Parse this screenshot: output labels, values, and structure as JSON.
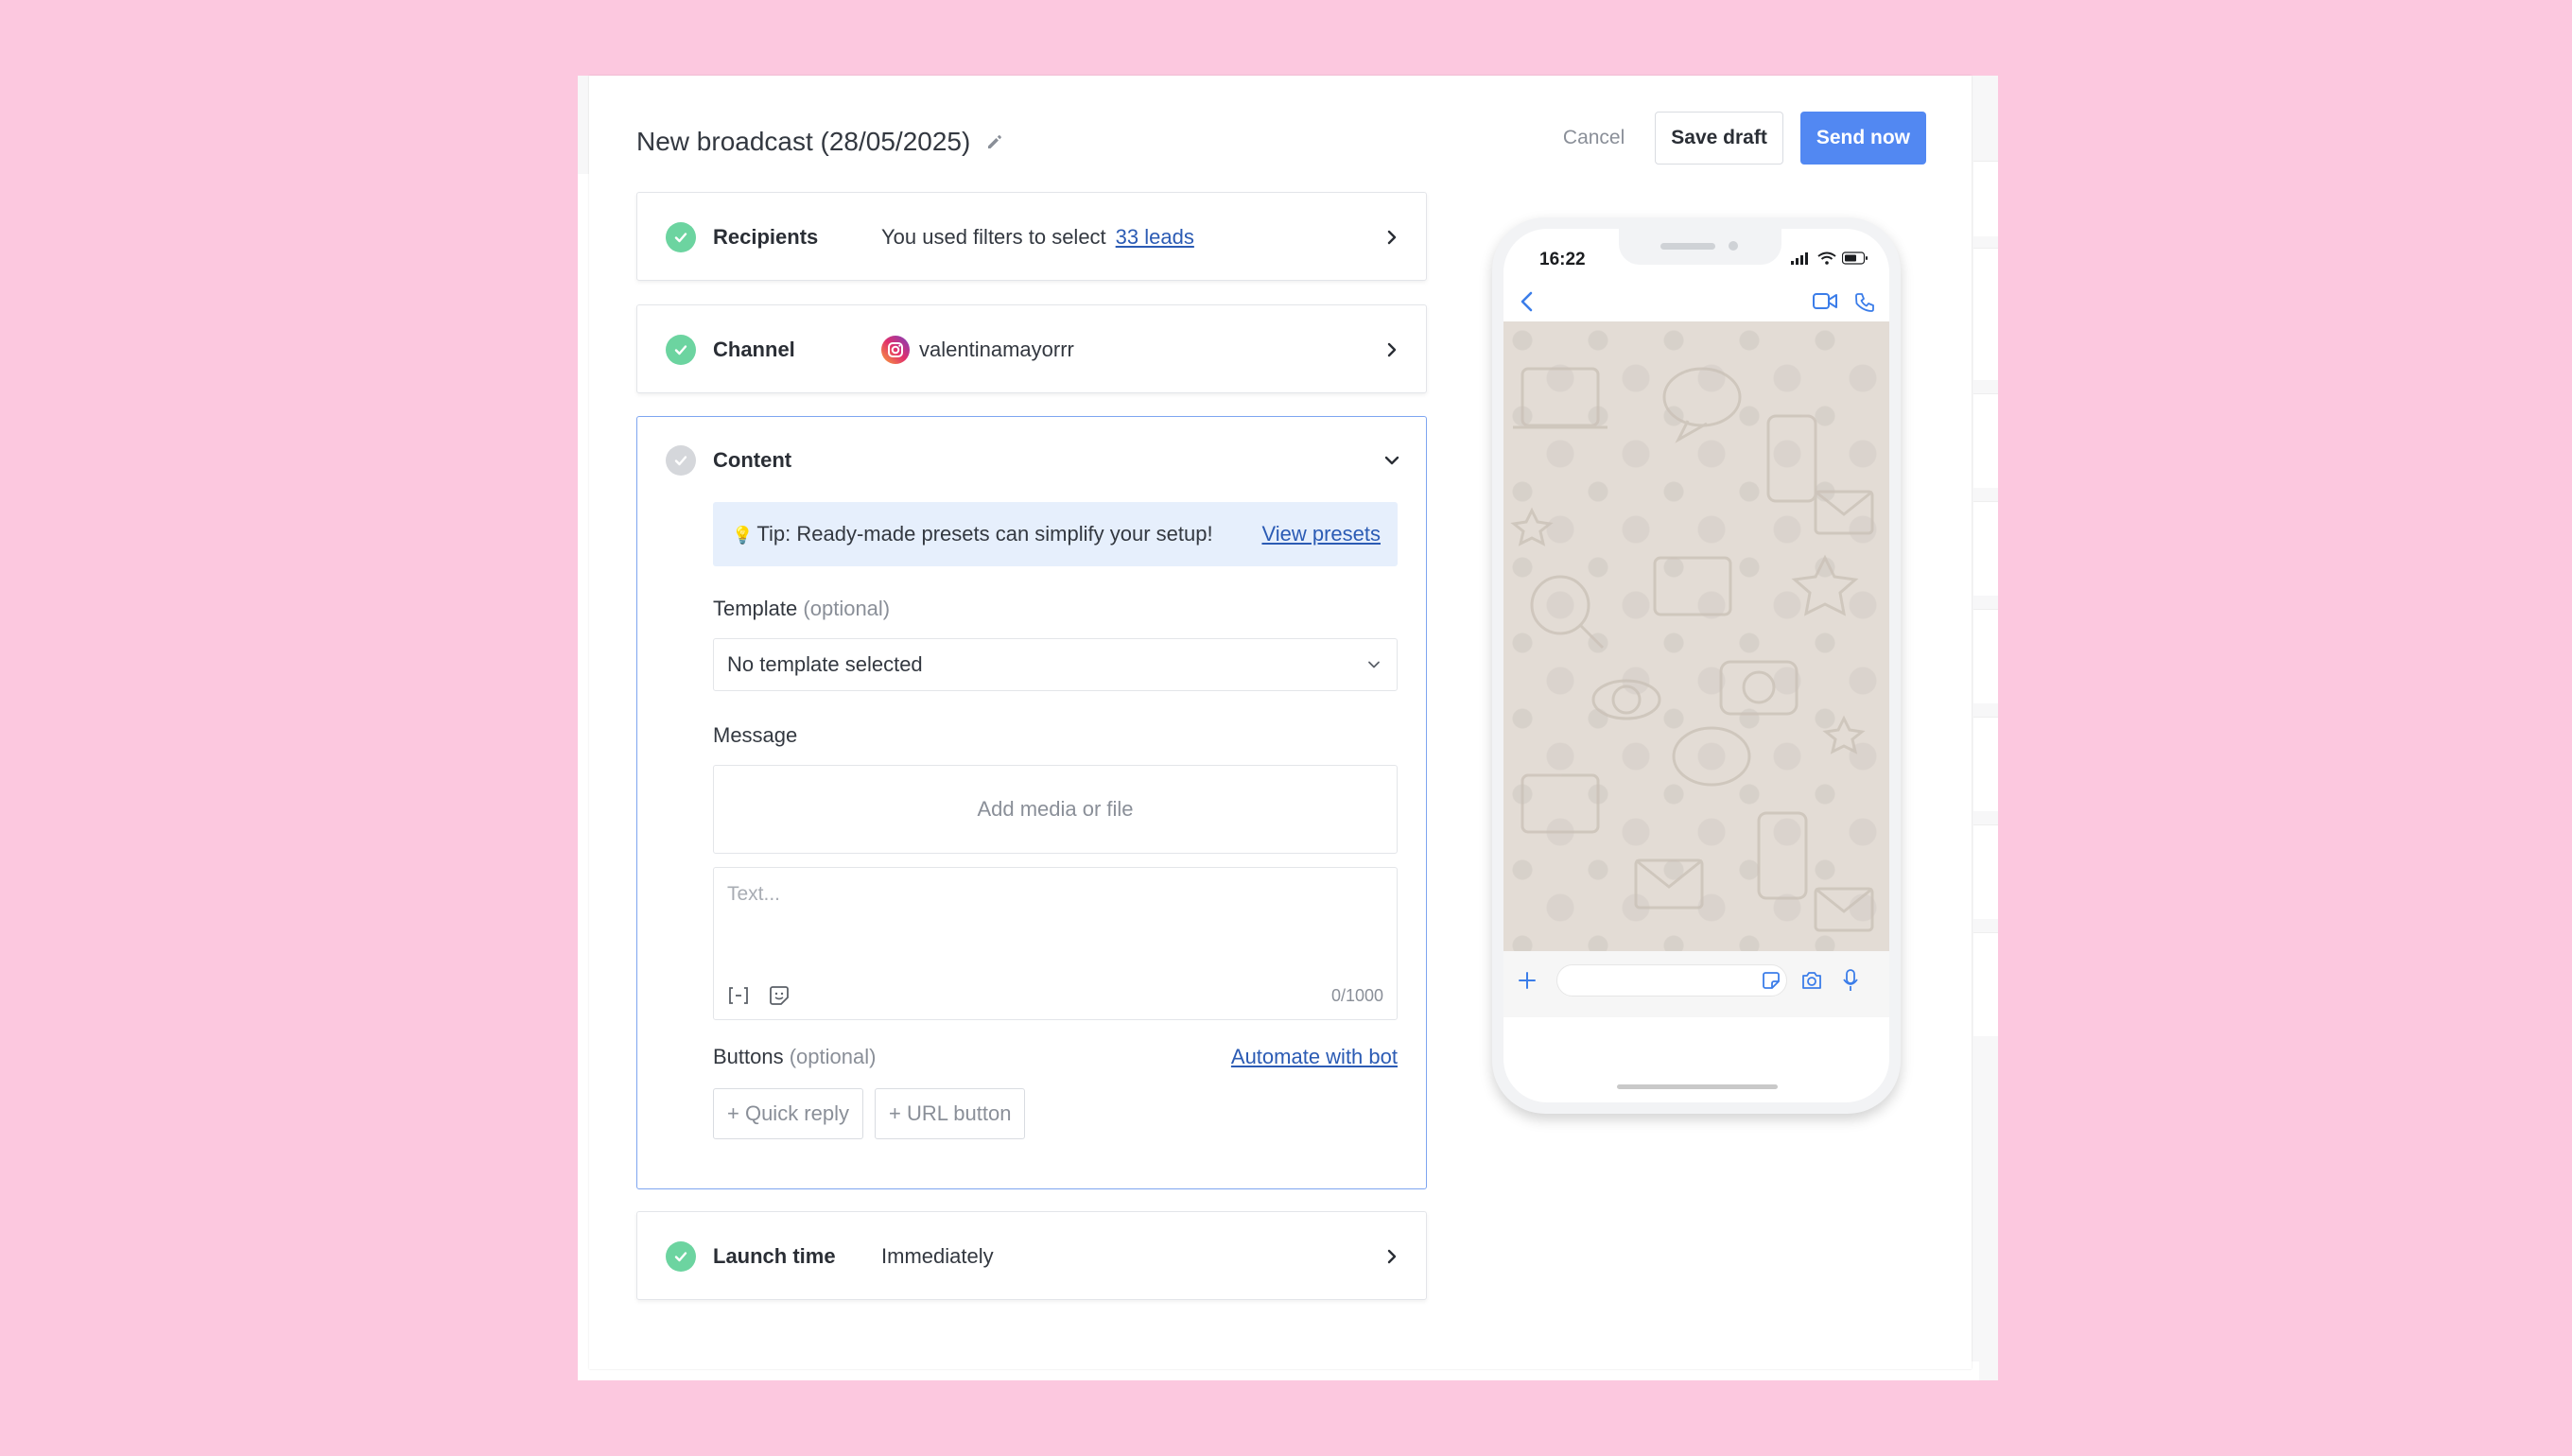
{
  "header": {
    "title": "New broadcast (28/05/2025)",
    "cancel_label": "Cancel",
    "save_draft_label": "Save draft",
    "send_now_label": "Send now"
  },
  "steps": {
    "recipients": {
      "label": "Recipients",
      "value_prefix": "You used filters to select",
      "value_link": "33 leads",
      "status": "complete"
    },
    "channel": {
      "label": "Channel",
      "value": "valentinamayorrr",
      "icon": "instagram-icon",
      "status": "complete"
    },
    "content": {
      "label": "Content",
      "status": "incomplete",
      "tip_text": "Tip: Ready-made presets can simplify your setup!",
      "tip_link": "View presets",
      "template_label": "Template",
      "template_optional": "(optional)",
      "template_value": "No template selected",
      "message_label": "Message",
      "media_placeholder": "Add media or file",
      "text_placeholder": "Text...",
      "char_counter": "0/1000",
      "buttons_label": "Buttons",
      "buttons_optional": "(optional)",
      "automate_link": "Automate with bot",
      "quick_reply_label": "+ Quick reply",
      "url_button_label": "+ URL button"
    },
    "launch_time": {
      "label": "Launch time",
      "value": "Immediately",
      "status": "complete"
    }
  },
  "phone_preview": {
    "time": "16:22"
  },
  "colors": {
    "background": "#fcc8df",
    "primary": "#5288f2",
    "success": "#6cd4a0",
    "link": "#2b5bb4"
  }
}
